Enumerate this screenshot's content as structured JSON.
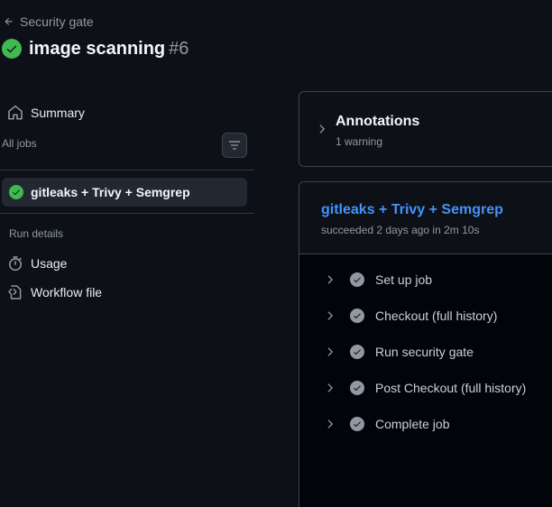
{
  "header": {
    "back_label": "Security gate",
    "run_title": "image scanning",
    "run_number": "#6"
  },
  "sidebar": {
    "summary_label": "Summary",
    "all_jobs_label": "All jobs",
    "jobs": [
      {
        "label": "gitleaks + Trivy + Semgrep",
        "status": "success"
      }
    ],
    "run_details_label": "Run details",
    "details": [
      {
        "label": "Usage",
        "icon": "stopwatch-icon"
      },
      {
        "label": "Workflow file",
        "icon": "workflow-file-icon"
      }
    ]
  },
  "annotations": {
    "title": "Annotations",
    "subtitle": "1 warning"
  },
  "job": {
    "title": "gitleaks + Trivy + Semgrep",
    "subtitle": "succeeded 2 days ago in 2m 10s",
    "steps": [
      {
        "label": "Set up job",
        "status": "success"
      },
      {
        "label": "Checkout (full history)",
        "status": "success"
      },
      {
        "label": "Run security gate",
        "status": "success"
      },
      {
        "label": "Post Checkout (full history)",
        "status": "success"
      },
      {
        "label": "Complete job",
        "status": "success"
      }
    ]
  },
  "colors": {
    "background": "#0d1117",
    "success": "#3fb950",
    "link": "#4493f8",
    "muted": "#9198a1"
  }
}
